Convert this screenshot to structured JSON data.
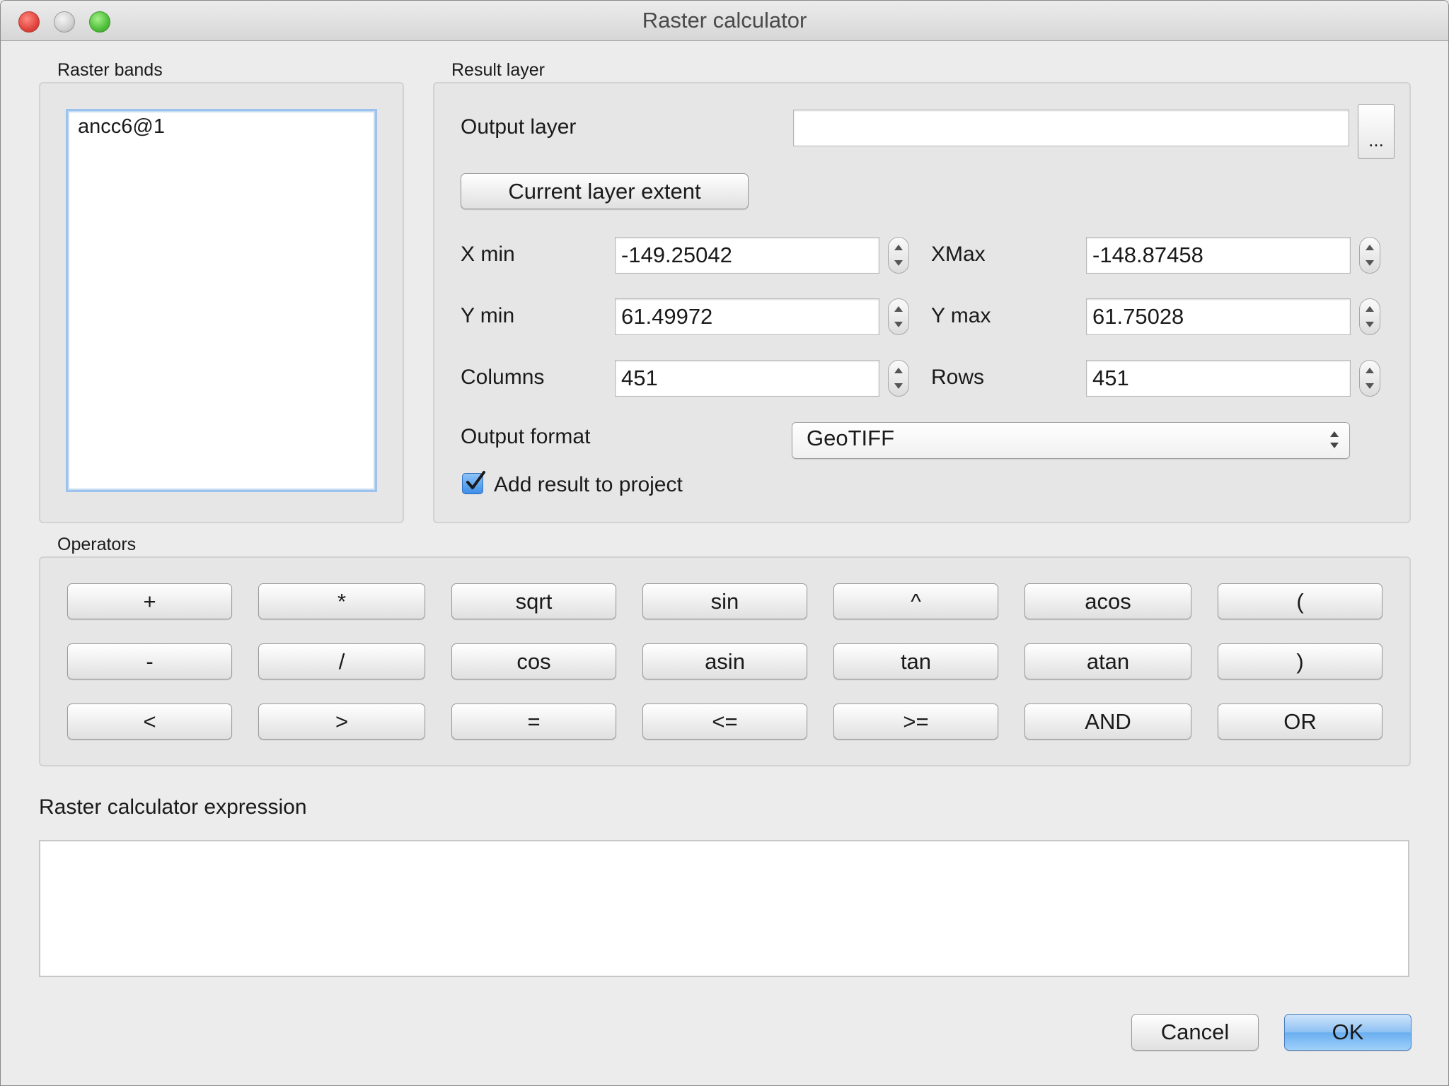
{
  "window": {
    "title": "Raster calculator"
  },
  "raster_bands": {
    "label": "Raster bands",
    "items": [
      "ancc6@1"
    ]
  },
  "result_layer": {
    "label": "Result layer",
    "output_layer_label": "Output layer",
    "output_layer_value": "",
    "browse_label": "...",
    "current_extent_button": "Current layer extent",
    "x_min_label": "X min",
    "x_min_value": "-149.25042",
    "x_max_label": "XMax",
    "x_max_value": "-148.87458",
    "y_min_label": "Y min",
    "y_min_value": "61.49972",
    "y_max_label": "Y max",
    "y_max_value": "61.75028",
    "columns_label": "Columns",
    "columns_value": "451",
    "rows_label": "Rows",
    "rows_value": "451",
    "output_format_label": "Output format",
    "output_format_value": "GeoTIFF",
    "add_result_label": "Add result to project",
    "add_result_checked": true
  },
  "operators": {
    "label": "Operators",
    "rows": [
      [
        "+",
        "*",
        "sqrt",
        "sin",
        "^",
        "acos",
        "("
      ],
      [
        "-",
        "/",
        "cos",
        "asin",
        "tan",
        "atan",
        ")"
      ],
      [
        "<",
        ">",
        "=",
        "<=",
        ">=",
        "AND",
        "OR"
      ]
    ]
  },
  "expression": {
    "label": "Raster calculator expression",
    "value": ""
  },
  "footer": {
    "cancel_label": "Cancel",
    "ok_label": "OK"
  },
  "colors": {
    "accent": "#6aaef0",
    "checkbox": "#3c8ee8"
  }
}
